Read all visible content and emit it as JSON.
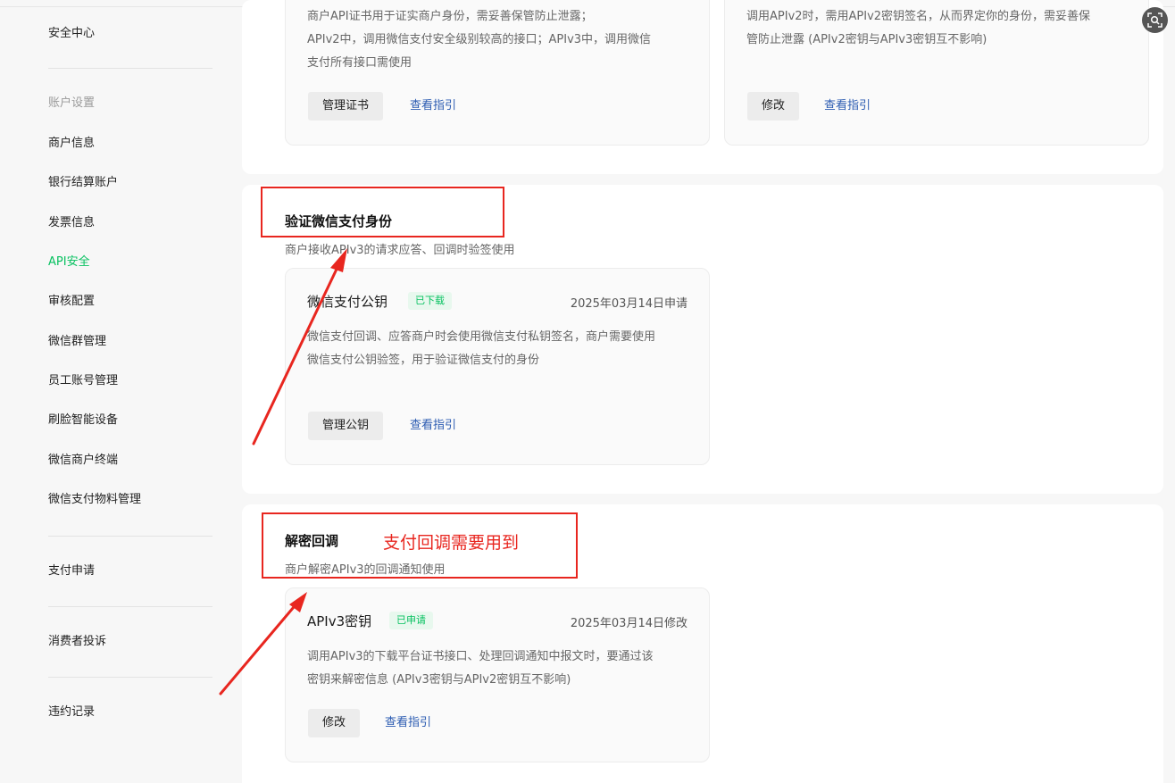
{
  "sidebar": {
    "top_item": "安全中心",
    "group_label": "账户设置",
    "items": [
      {
        "label": "商户信息"
      },
      {
        "label": "银行结算账户"
      },
      {
        "label": "发票信息"
      },
      {
        "label": "API安全",
        "active": true
      },
      {
        "label": "审核配置"
      },
      {
        "label": "微信群管理"
      },
      {
        "label": "员工账号管理"
      },
      {
        "label": "刷脸智能设备"
      },
      {
        "label": "微信商户终端"
      },
      {
        "label": "微信支付物料管理"
      }
    ],
    "pay_apply": "支付申请",
    "complaints": "消费者投诉",
    "violations": "违约记录"
  },
  "top_section": {
    "cert_card": {
      "desc_lines": [
        "商户API证书用于证实商户身份，需妥善保管防止泄露；",
        "APIv2中，调用微信支付安全级别较高的接口；APIv3中，调用微信",
        "支付所有接口需使用"
      ],
      "button_label": "管理证书",
      "link_label": "查看指引"
    },
    "v2_card": {
      "desc_lines": [
        "调用APIv2时，需用APIv2密钥签名，从而界定你的身份，需妥善保",
        "管防止泄露 (APIv2密钥与APIv3密钥互不影响)"
      ],
      "button_label": "修改",
      "link_label": "查看指引"
    }
  },
  "verify_section": {
    "title": "验证微信支付身份",
    "desc": "商户接收APIv3的请求应答、回调时验签使用",
    "card": {
      "title": "微信支付公钥",
      "badge": "已下载",
      "date": "2025年03月14日申请",
      "desc_lines": [
        "微信支付回调、应答商户时会使用微信支付私钥签名，商户需要使用",
        "微信支付公钥验签，用于验证微信支付的身份"
      ],
      "button_label": "管理公钥",
      "link_label": "查看指引"
    }
  },
  "decrypt_section": {
    "title": "解密回调",
    "annotation": "支付回调需要用到",
    "desc": "商户解密APIv3的回调通知使用",
    "card": {
      "title": "APIv3密钥",
      "badge": "已申请",
      "date": "2025年03月14日修改",
      "desc_lines": [
        "调用APIv3的下载平台证书接口、处理回调通知中报文时，要通过该",
        "密钥来解密信息 (APIv3密钥与APIv2密钥互不影响)"
      ],
      "button_label": "修改",
      "link_label": "查看指引"
    }
  },
  "colors": {
    "accent": "#07c160",
    "link": "#2b5bb1",
    "annotation": "#e8261f"
  },
  "icons": {
    "floating": "screenshot-search-icon"
  }
}
